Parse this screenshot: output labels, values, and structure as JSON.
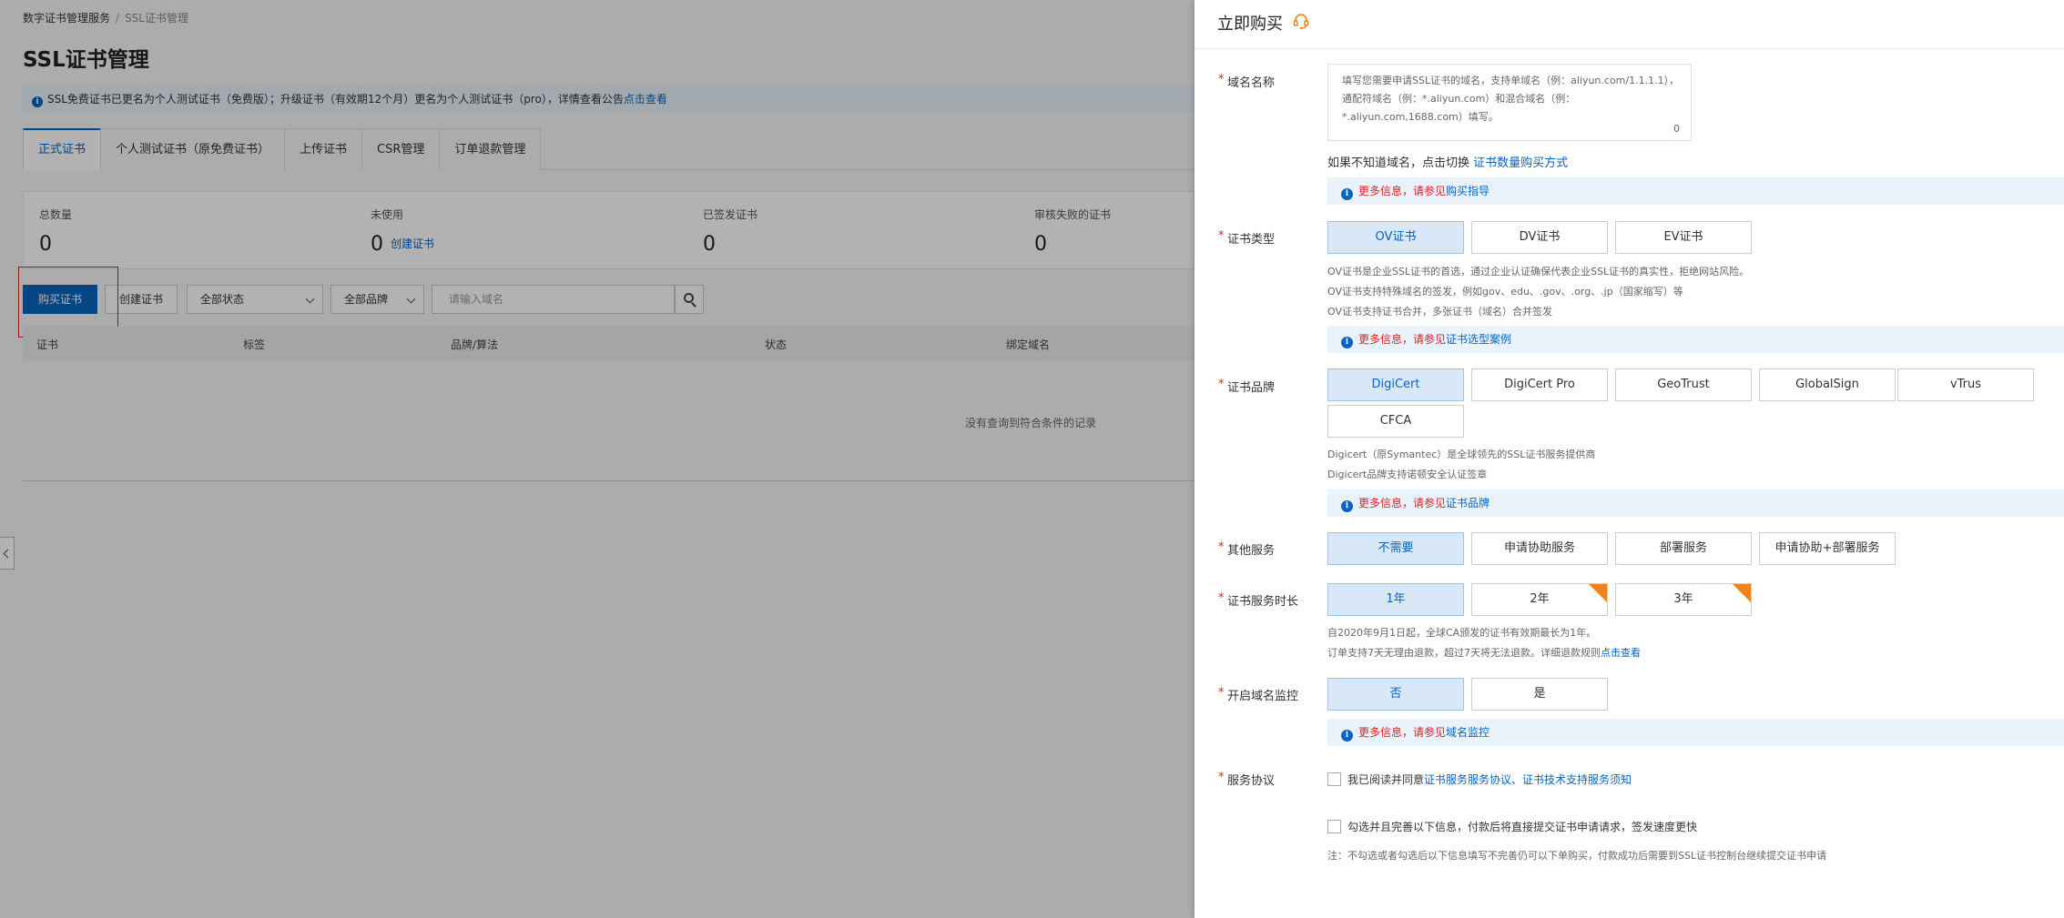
{
  "breadcrumb": {
    "root": "数字证书管理服务",
    "sep": "/",
    "current": "SSL证书管理"
  },
  "page_title": "SSL证书管理",
  "notice": {
    "text": "SSL免费证书已更名为个人测试证书（免费版）；升级证书（有效期12个月）更名为个人测试证书（pro），详情查看公告",
    "link": "点击查看"
  },
  "tabs": [
    "正式证书",
    "个人测试证书（原免费证书）",
    "上传证书",
    "CSR管理",
    "订单退款管理"
  ],
  "stats": [
    {
      "label": "总数量",
      "value": "0"
    },
    {
      "label": "未使用",
      "value": "0",
      "link": "创建证书"
    },
    {
      "label": "已签发证书",
      "value": "0"
    },
    {
      "label": "审核失败的证书",
      "value": "0"
    }
  ],
  "toolbar": {
    "buy": "购买证书",
    "create": "创建证书",
    "status_select": "全部状态",
    "brand_select": "全部品牌",
    "search_placeholder": "请输入域名"
  },
  "table": {
    "headers": [
      "证书",
      "标签",
      "品牌/算法",
      "状态",
      "绑定域名"
    ],
    "empty": "没有查询到符合条件的记录"
  },
  "drawer": {
    "title": "立即购买",
    "required_mark": "*",
    "domain": {
      "label": "域名名称",
      "placeholder": "填写您需要申请SSL证书的域名，支持单域名（例：aliyun.com/1.1.1.1），通配符域名（例：*.aliyun.com）和混合域名（例：*.aliyun.com,1688.com）填写。",
      "count": "0",
      "hint": "如果不知道域名，点击切换",
      "hint_link": "证书数量购买方式",
      "info": "更多信息，请参见",
      "info_link": "购买指导"
    },
    "cert_type": {
      "label": "证书类型",
      "options": [
        "OV证书",
        "DV证书",
        "EV证书"
      ],
      "desc": [
        "OV证书是企业SSL证书的首选，通过企业认证确保代表企业SSL证书的真实性，拒绝网站风险。",
        "OV证书支持特殊域名的签发，例如gov、edu、.gov、.org、.jp（国家缩写）等",
        "OV证书支持证书合并，多张证书（域名）合并签发"
      ],
      "info": "更多信息，请参见",
      "info_link": "证书选型案例"
    },
    "brand": {
      "label": "证书品牌",
      "options": [
        "DigiCert",
        "DigiCert Pro",
        "GeoTrust",
        "GlobalSign",
        "vTrus",
        "CFCA"
      ],
      "desc": [
        "Digicert（原Symantec）是全球领先的SSL证书服务提供商",
        "Digicert品牌支持诺顿安全认证签章"
      ],
      "info": "更多信息，请参见",
      "info_link": "证书品牌"
    },
    "other_service": {
      "label": "其他服务",
      "options": [
        "不需要",
        "申请协助服务",
        "部署服务",
        "申请协助+部署服务"
      ]
    },
    "duration": {
      "label": "证书服务时长",
      "options": [
        "1年",
        "2年",
        "3年"
      ],
      "desc1": "自2020年9月1日起，全球CA颁发的证书有效期最长为1年。",
      "desc2": "订单支持7天无理由退款，超过7天将无法退款。详细退款规则",
      "desc2_link": "点击查看"
    },
    "monitor": {
      "label": "开启域名监控",
      "options": [
        "否",
        "是"
      ],
      "info": "更多信息，请参见",
      "info_link": "域名监控"
    },
    "agreement": {
      "label": "服务协议",
      "text": "我已阅读并同意",
      "link": "证书服务服务协议、证书技术支持服务须知",
      "fill_text": "勾选并且完善以下信息，付款后将直接提交证书申请请求，签发速度更快",
      "note": "注：不勾选或者勾选后以下信息填写不完善仍可以下单购买，付款成功后需要到SSL证书控制台继续提交证书申请"
    }
  },
  "colors": {
    "primary": "#0a63bc",
    "danger": "#e01f1f",
    "selected_bg": "#d8e8f6",
    "badge": "#f0831a"
  }
}
